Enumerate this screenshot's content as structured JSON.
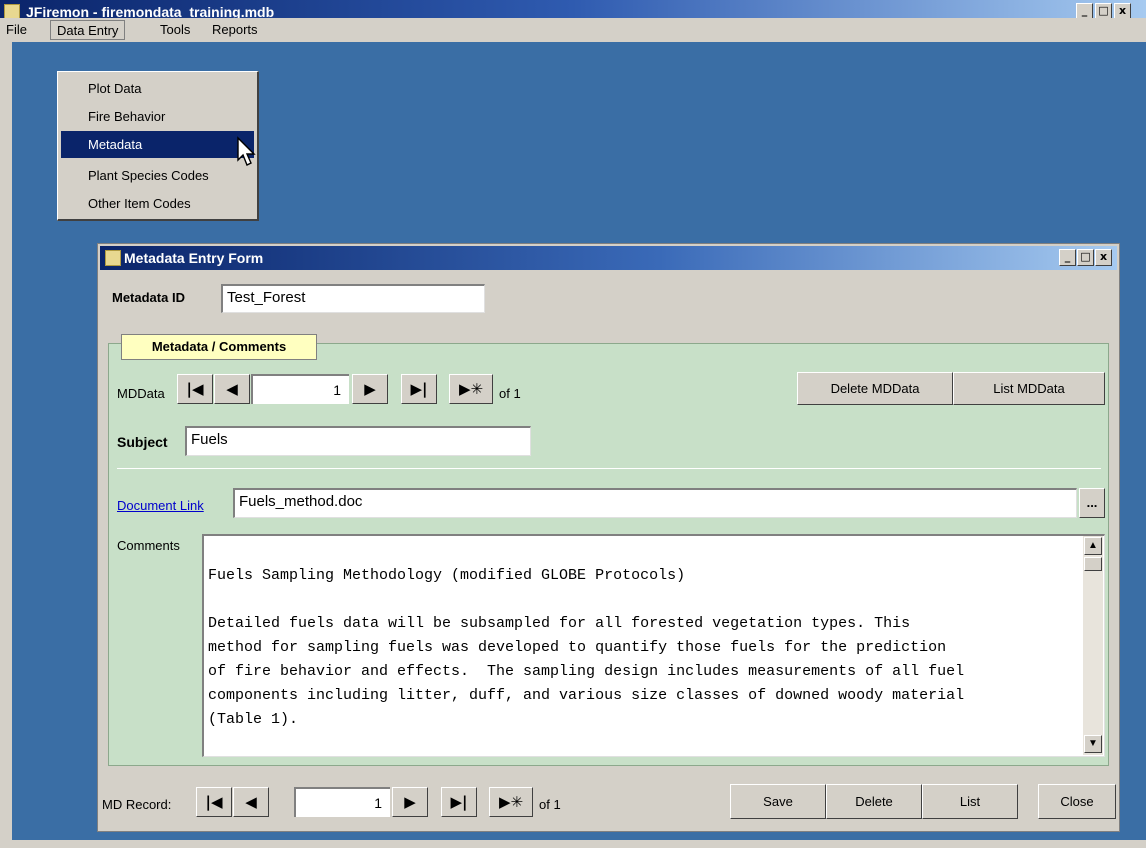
{
  "app": {
    "title": "JFiremon - firemondata_training.mdb",
    "window_buttons": [
      "_",
      "□",
      "x"
    ]
  },
  "menubar": {
    "items": [
      "File",
      "Data Entry",
      "Tools",
      "Reports"
    ]
  },
  "data_entry_menu": {
    "items": [
      "Plot Data",
      "Fire Behavior",
      "Metadata",
      "Plant Species Codes",
      "Other Item Codes"
    ],
    "selected": "Metadata"
  },
  "form": {
    "title": "Metadata Entry Form",
    "metadata_id_label": "Metadata ID",
    "metadata_id_value": "Test_Forest",
    "tab_label": "Metadata / Comments",
    "mddata_label": "MDData",
    "mddata_record": "1",
    "mddata_of": "of 1",
    "delete_mddata": "Delete MDData",
    "list_mddata": "List MDData",
    "subject_label": "Subject",
    "subject_value": "Fuels",
    "document_link_label": "Document Link",
    "document_link_value": "Fuels_method.doc",
    "browse_label": "...",
    "comments_label": "Comments",
    "comments_lines": [
      "",
      "Fuels Sampling Methodology (modified GLOBE Protocols)",
      "",
      "Detailed fuels data will be subsampled for all forested vegetation types. This",
      "method for sampling fuels was developed to quantify those fuels for the prediction",
      "of fire behavior and effects.  The sampling design includes measurements of all fuel",
      "components including litter, duff, and various size classes of downed woody material",
      "(Table 1)."
    ],
    "md_record_label": "MD Record:",
    "md_record_value": "1",
    "md_record_of": "of 1",
    "save": "Save",
    "delete": "Delete",
    "list": "List",
    "close": "Close"
  },
  "nav_glyphs": {
    "first": "|◀",
    "prev": "◀",
    "next": "▶",
    "last": "▶|",
    "new": "▶✳"
  },
  "colors": {
    "desktop": "#3a6ea5",
    "panel": "#c8e0c8",
    "tab": "#ffffc0",
    "link": "#0000cc"
  }
}
